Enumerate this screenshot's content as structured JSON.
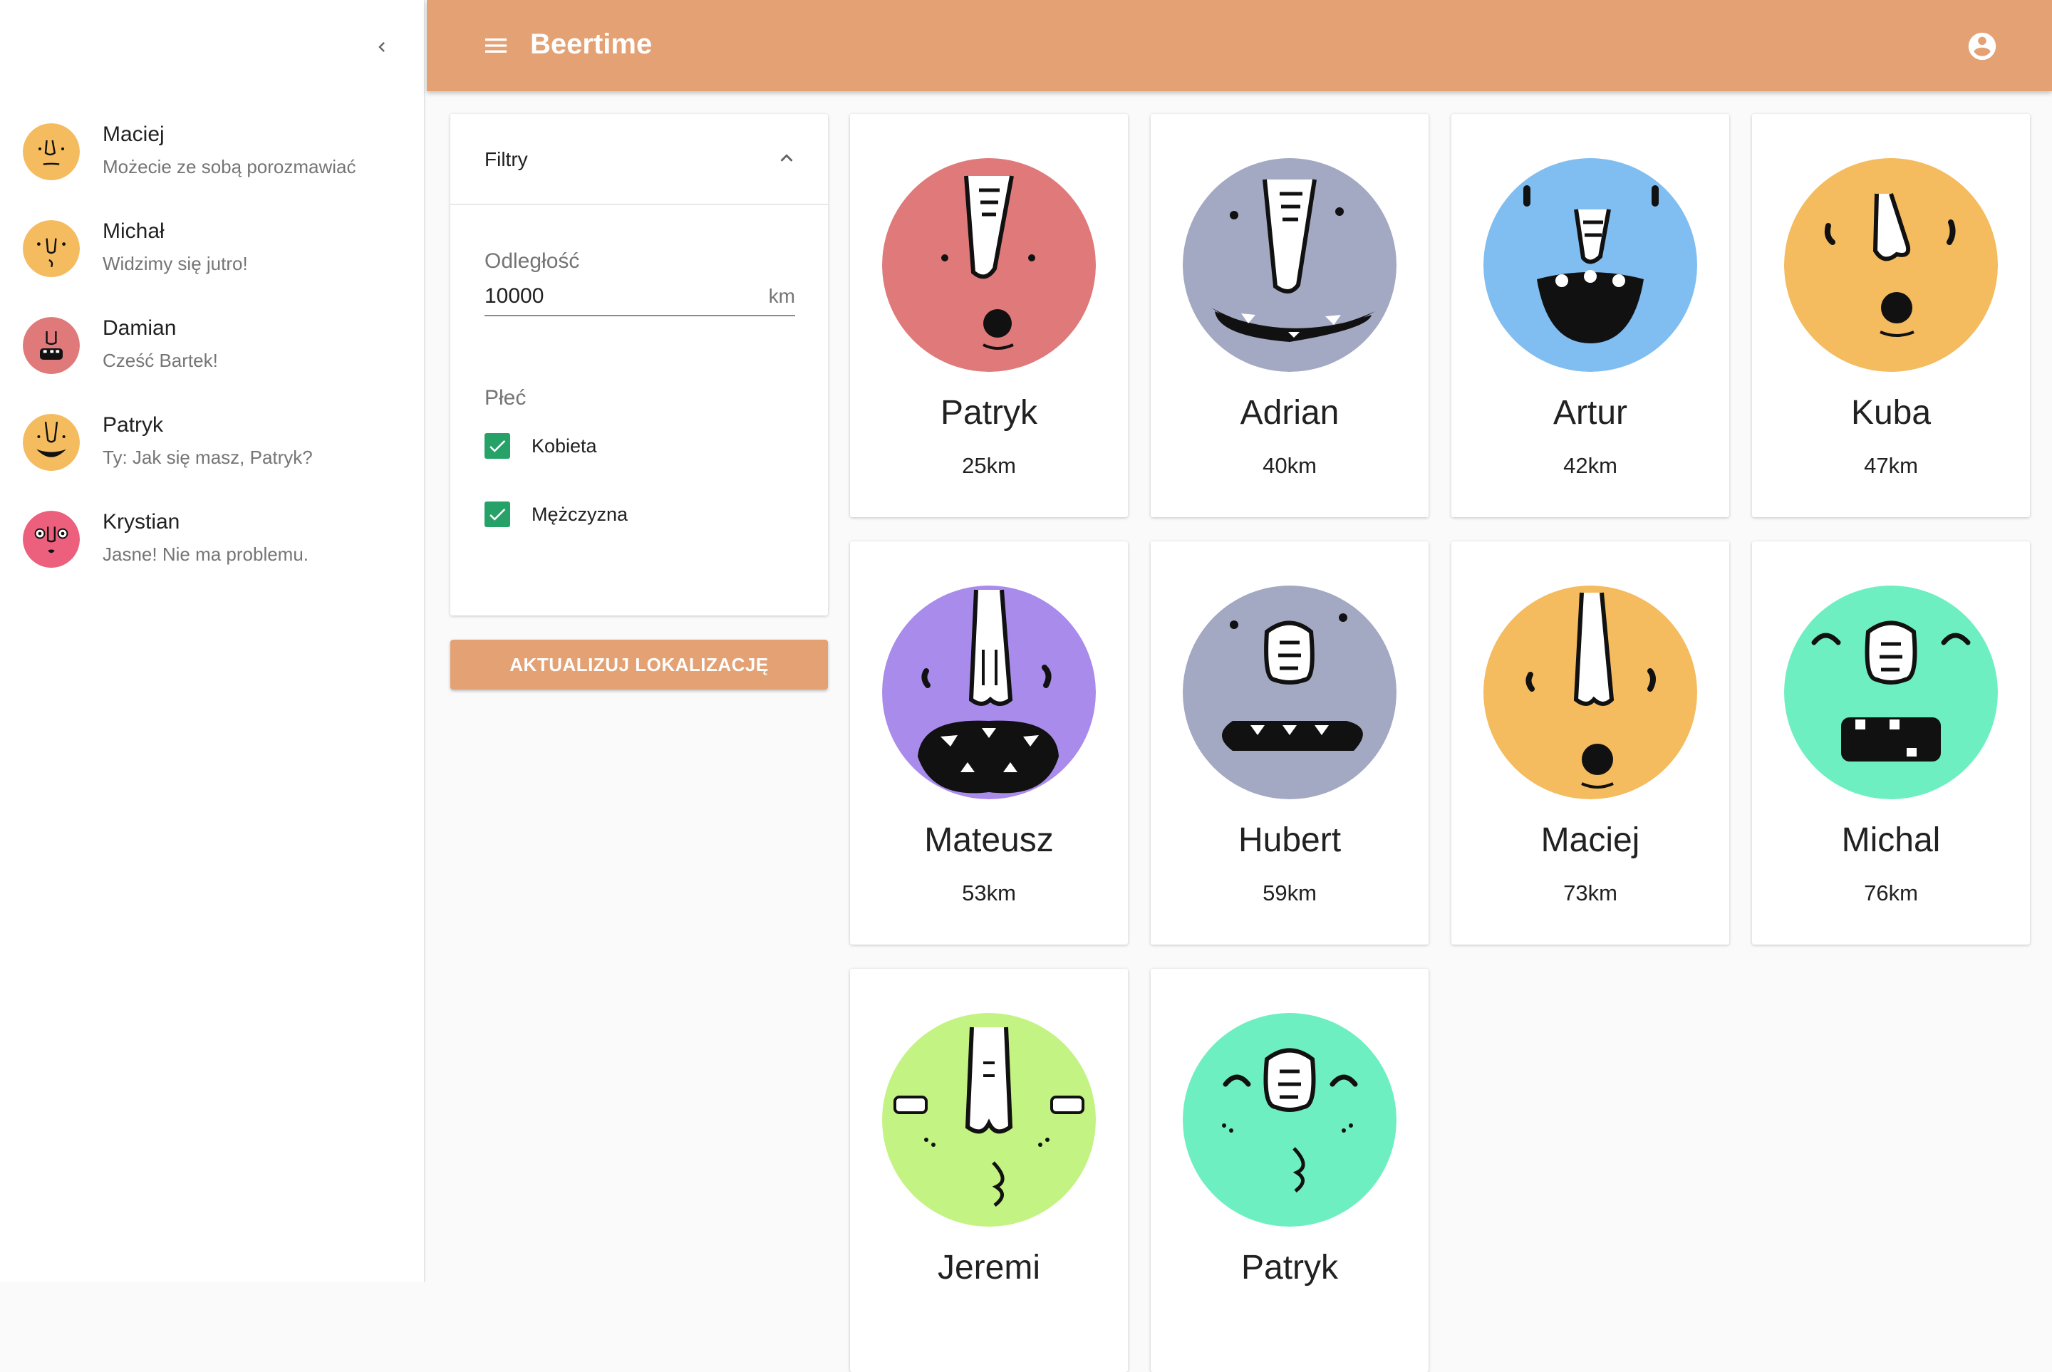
{
  "app": {
    "title": "Beertime",
    "accent_color": "#e3a174",
    "checkbox_color": "#26a269"
  },
  "sidebar": {
    "collapse_icon": "chevron-left-icon",
    "chats": [
      {
        "name": "Maciej",
        "message": "Możecie ze sobą porozmawiać",
        "avatar_color": "#f4bb5f"
      },
      {
        "name": "Michał",
        "message": "Widzimy się jutro!",
        "avatar_color": "#f4bb5f"
      },
      {
        "name": "Damian",
        "message": "Cześć Bartek!",
        "avatar_color": "#e07a7a"
      },
      {
        "name": "Patryk",
        "message": "Ty: Jak się masz, Patryk?",
        "avatar_color": "#f4bb5f"
      },
      {
        "name": "Krystian",
        "message": "Jasne! Nie ma problemu.",
        "avatar_color": "#ec5f7d"
      }
    ]
  },
  "toolbar": {
    "menu_icon": "menu-icon",
    "account_icon": "account-circle-icon"
  },
  "filters": {
    "title": "Filtry",
    "distance_label": "Odległość",
    "distance_value": "10000",
    "distance_unit": "km",
    "gender_label": "Płeć",
    "options": [
      {
        "label": "Kobieta",
        "checked": true
      },
      {
        "label": "Mężczyzna",
        "checked": true
      }
    ],
    "update_button": "AKTUALIZUJ LOKALIZACJĘ"
  },
  "users": [
    {
      "name": "Patryk",
      "distance": "25km",
      "avatar_color": "#e07a7a"
    },
    {
      "name": "Adrian",
      "distance": "40km",
      "avatar_color": "#a3a8c3"
    },
    {
      "name": "Artur",
      "distance": "42km",
      "avatar_color": "#80bdf0"
    },
    {
      "name": "Kuba",
      "distance": "47km",
      "avatar_color": "#f4bb5f"
    },
    {
      "name": "Mateusz",
      "distance": "53km",
      "avatar_color": "#a98bec"
    },
    {
      "name": "Hubert",
      "distance": "59km",
      "avatar_color": "#a3a8c3"
    },
    {
      "name": "Maciej",
      "distance": "73km",
      "avatar_color": "#f4bb5f"
    },
    {
      "name": "Michal",
      "distance": "76km",
      "avatar_color": "#6eefc2"
    },
    {
      "name": "Jeremi",
      "distance": "",
      "avatar_color": "#c3f382"
    },
    {
      "name": "Patryk",
      "distance": "",
      "avatar_color": "#6eefc2"
    }
  ]
}
